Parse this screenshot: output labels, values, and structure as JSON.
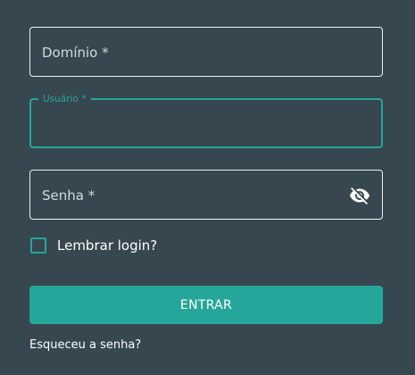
{
  "form": {
    "domain_field": {
      "label": "Domínio *",
      "value": ""
    },
    "user_field": {
      "label": "Usuário *",
      "value": "",
      "focused": true
    },
    "password_field": {
      "label": "Senha *",
      "value": "",
      "toggle_icon": "eye-off-icon"
    },
    "remember": {
      "label": "Lembrar login?",
      "checked": false
    },
    "submit_label": "ENTRAR",
    "forgot_link": "Esqueceu a senha?"
  },
  "colors": {
    "background": "#37474f",
    "accent": "#26a69a",
    "text": "#ffffff",
    "border": "#eef1f2"
  }
}
